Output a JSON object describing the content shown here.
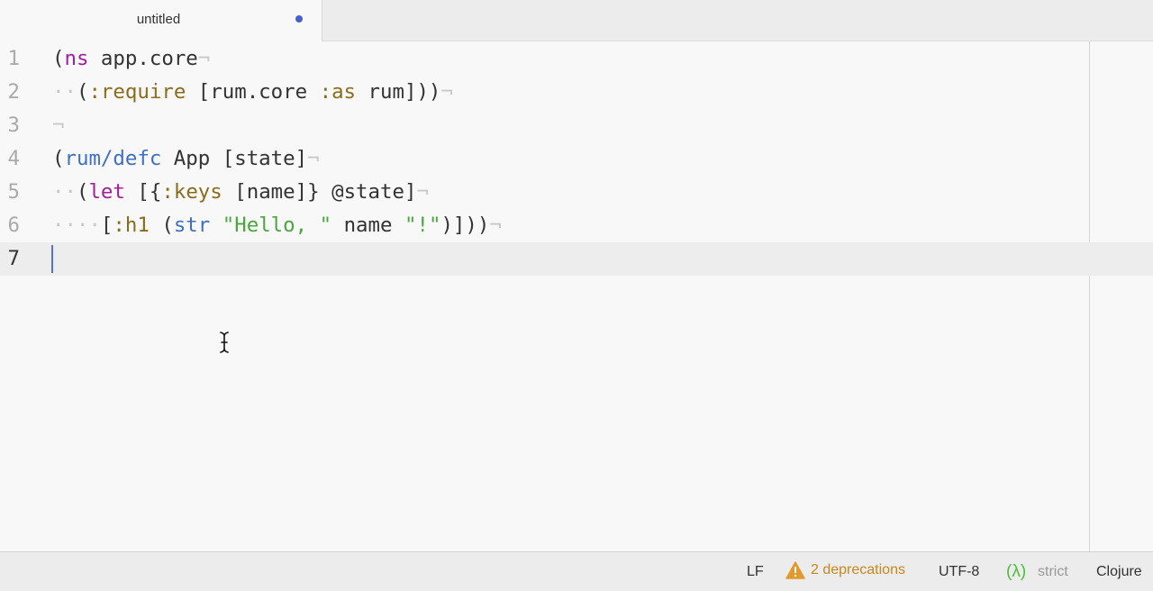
{
  "tab": {
    "title": "untitled",
    "modified_color": "#4560c9"
  },
  "editor": {
    "lines": [
      {
        "number": "1",
        "tokens": [
          {
            "text": "(",
            "cls": "plain"
          },
          {
            "text": "ns",
            "cls": "kw"
          },
          {
            "text": " app.core",
            "cls": "plain"
          },
          {
            "text": "¬",
            "cls": "inv"
          }
        ]
      },
      {
        "number": "2",
        "tokens": [
          {
            "text": "··",
            "cls": "inv"
          },
          {
            "text": "(",
            "cls": "plain"
          },
          {
            "text": ":require",
            "cls": "key"
          },
          {
            "text": " [rum.core ",
            "cls": "plain"
          },
          {
            "text": ":as",
            "cls": "key"
          },
          {
            "text": " rum]))",
            "cls": "plain"
          },
          {
            "text": "¬",
            "cls": "inv"
          }
        ]
      },
      {
        "number": "3",
        "tokens": [
          {
            "text": "¬",
            "cls": "inv"
          }
        ]
      },
      {
        "number": "4",
        "tokens": [
          {
            "text": "(",
            "cls": "plain"
          },
          {
            "text": "rum/defc",
            "cls": "fn"
          },
          {
            "text": " App [state]",
            "cls": "plain"
          },
          {
            "text": "¬",
            "cls": "inv"
          }
        ]
      },
      {
        "number": "5",
        "tokens": [
          {
            "text": "··",
            "cls": "inv"
          },
          {
            "text": "(",
            "cls": "plain"
          },
          {
            "text": "let",
            "cls": "kw"
          },
          {
            "text": " [{",
            "cls": "plain"
          },
          {
            "text": ":keys",
            "cls": "key"
          },
          {
            "text": " [name]} @state]",
            "cls": "plain"
          },
          {
            "text": "¬",
            "cls": "inv"
          }
        ]
      },
      {
        "number": "6",
        "tokens": [
          {
            "text": "····",
            "cls": "inv"
          },
          {
            "text": "[",
            "cls": "plain"
          },
          {
            "text": ":h1",
            "cls": "key"
          },
          {
            "text": " (",
            "cls": "plain"
          },
          {
            "text": "str",
            "cls": "fn"
          },
          {
            "text": " ",
            "cls": "plain"
          },
          {
            "text": "\"Hello, \"",
            "cls": "str"
          },
          {
            "text": " name ",
            "cls": "plain"
          },
          {
            "text": "\"!\"",
            "cls": "str"
          },
          {
            "text": ")]))",
            "cls": "plain"
          },
          {
            "text": "¬",
            "cls": "inv"
          }
        ]
      },
      {
        "number": "7",
        "tokens": [],
        "cursor": true
      }
    ]
  },
  "status": {
    "line_ending": "LF",
    "deprecations": "2 deprecations",
    "encoding": "UTF-8",
    "lambda": "(λ)",
    "mode": "strict",
    "grammar": "Clojure"
  },
  "icons": {
    "warning": "warning-icon",
    "cursor": "text-cursor-icon"
  }
}
